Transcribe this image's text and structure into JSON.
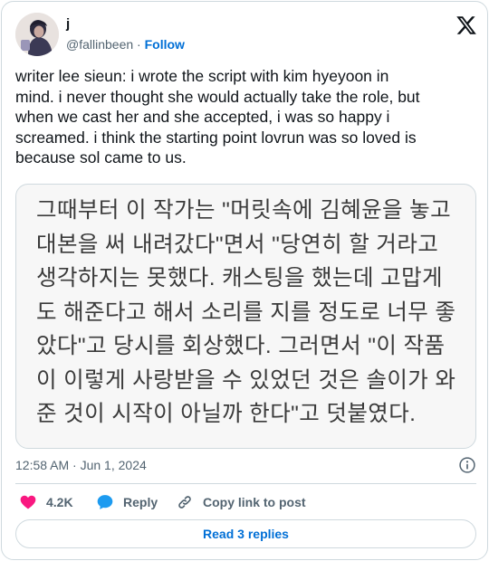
{
  "author": {
    "display_name": "j",
    "handle": "@fallinbeen",
    "separator": "·",
    "follow_label": "Follow"
  },
  "tweet": {
    "text": "writer lee sieun: i wrote the script with kim hyeyoon in\nmind. i never thought she would actually take the role, but\nwhen we cast her and she accepted, i was so happy i\nscreamed. i think the starting point lovrun was so loved is\nbecause sol came to us."
  },
  "media": {
    "lines": [
      "그때부터 이 작가는 \"머릿속에 김혜윤을 놓고",
      "대본을 써 내려갔다\"면서 \"당연히 할 거라고",
      "생각하지는 못했다. 캐스팅을 했는데 고맙게",
      "도 해준다고 해서 소리를 지를 정도로 너무 좋",
      "았다\"고 당시를 회상했다. 그러면서 \"이 작품",
      "이 이렇게 사랑받을 수 있었던 것은 솔이가 와",
      "준 것이 시작이 아닐까 한다\"고 덧붙였다."
    ]
  },
  "meta": {
    "timestamp": "12:58 AM · Jun 1, 2024",
    "info_icon": "info-icon"
  },
  "actions": {
    "likes": "4.2K",
    "reply_label": "Reply",
    "copy_label": "Copy link to post"
  },
  "replies_button": "Read 3 replies",
  "colors": {
    "accent": "#006fd6",
    "like": "#f91880",
    "reply_icon": "#1d9bf0",
    "border": "#cfd9de",
    "muted": "#536471"
  }
}
